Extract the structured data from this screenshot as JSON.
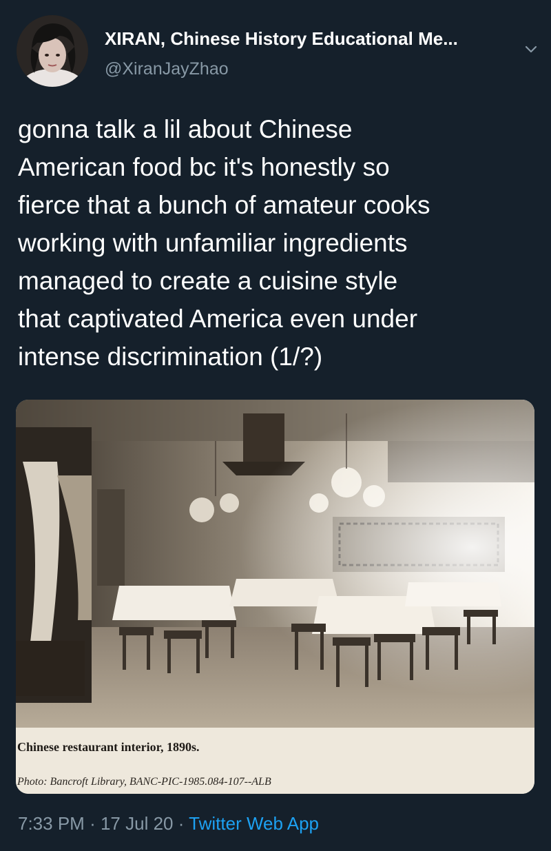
{
  "user": {
    "display_name": "XIRAN, Chinese History Educational Me...",
    "handle": "@XiranJayZhao",
    "avatar_icon": "profile-photo",
    "menu_icon": "chevron-down-icon"
  },
  "tweet": {
    "text_lines": [
      "gonna talk a lil about Chinese",
      "American food bc it's honestly so",
      "fierce that a bunch of amateur cooks",
      "working with unfamiliar ingredients",
      "managed to create a cuisine style",
      "that captivated America even under",
      "intense discrimination (1/?)"
    ]
  },
  "media": {
    "caption_title": "Chinese restaurant interior, 1890s.",
    "caption_credit": "Photo: Bancroft Library, BANC-PIC-1985.084-107--ALB"
  },
  "meta": {
    "time": "7:33 PM",
    "sep1": "·",
    "date": "17 Jul 20",
    "sep2": "·",
    "source": "Twitter Web App"
  },
  "colors": {
    "background": "#15202b",
    "text": "#ffffff",
    "secondary": "#8899a6",
    "link": "#1da1f2"
  }
}
